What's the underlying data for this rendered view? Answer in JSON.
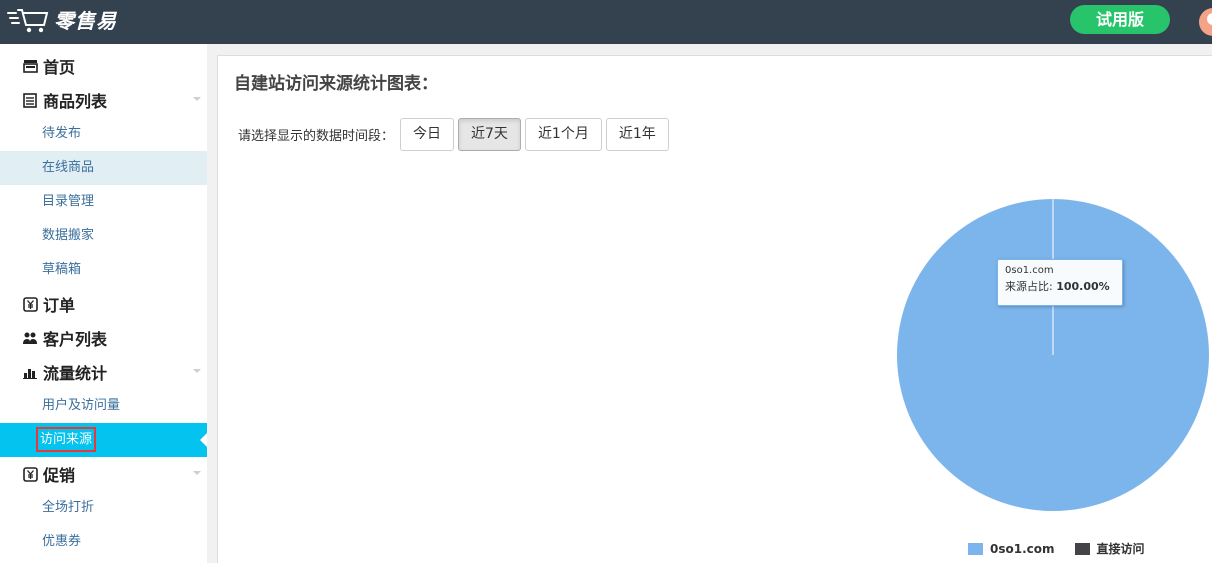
{
  "header": {
    "logo_text": "零售易",
    "trial_label": "试用版"
  },
  "sidebar": {
    "home": "首页",
    "product_list": {
      "label": "商品列表",
      "items": [
        "待发布",
        "在线商品",
        "目录管理",
        "数据搬家",
        "草稿箱"
      ]
    },
    "orders": "订单",
    "customers": "客户列表",
    "traffic": {
      "label": "流量统计",
      "items": [
        "用户及访问量",
        "访问来源"
      ]
    },
    "promotion": {
      "label": "促销",
      "items": [
        "全场打折",
        "优惠券"
      ]
    }
  },
  "main": {
    "title": "自建站访问来源统计图表：",
    "filter_label": "请选择显示的数据时间段：",
    "periods": [
      "今日",
      "近7天",
      "近1个月",
      "近1年"
    ],
    "active_period": "近7天"
  },
  "tooltip": {
    "name": "0so1.com",
    "label": "来源占比: ",
    "value": "100.00%"
  },
  "colors": {
    "topbar": "#34424f",
    "accent": "#05c3ef",
    "trial": "#27c46b",
    "slice_1": "#7cb5ec",
    "slice_2": "#434348"
  },
  "chart_data": {
    "type": "pie",
    "series": [
      {
        "name": "来源占比",
        "data": [
          {
            "label": "0so1.com",
            "value": 100.0,
            "color": "#7cb5ec"
          },
          {
            "label": "直接访问",
            "value": 0.0,
            "color": "#434348"
          }
        ]
      }
    ],
    "legend": [
      "0so1.com",
      "直接访问"
    ],
    "legend_position": "bottom"
  }
}
